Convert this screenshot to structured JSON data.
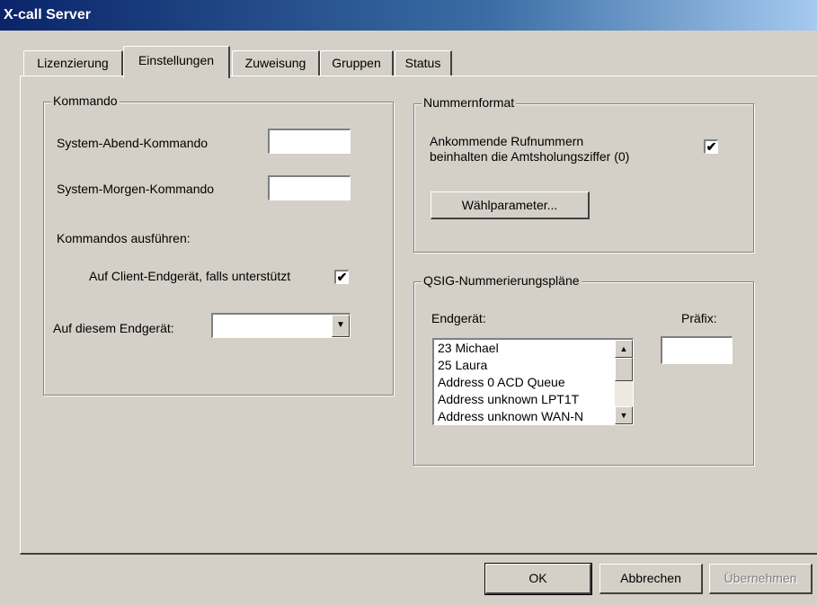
{
  "window": {
    "title": "X-call Server"
  },
  "tabs": [
    {
      "label": "Lizenzierung"
    },
    {
      "label": "Einstellungen"
    },
    {
      "label": "Zuweisung"
    },
    {
      "label": "Gruppen"
    },
    {
      "label": "Status"
    }
  ],
  "kommando": {
    "title": "Kommando",
    "abend_label": "System-Abend-Kommando",
    "abend_value": "",
    "morgen_label": "System-Morgen-Kommando",
    "morgen_value": "",
    "ausfuehren_label": "Kommandos ausführen:",
    "client_label": "Auf Client-Endgerät, falls unterstützt",
    "client_checked": true,
    "endgeraet_label": "Auf diesem Endgerät:",
    "endgeraet_value": ""
  },
  "nummernformat": {
    "title": "Nummernformat",
    "line1": "Ankommende Rufnummern",
    "line2": "beinhalten die Amtsholungsziffer (0)",
    "checked": true,
    "button": "Wählparameter..."
  },
  "qsig": {
    "title": "QSIG-Nummerierungspläne",
    "endgeraet_label": "Endgerät:",
    "praefix_label": "Präfix:",
    "praefix_value": "",
    "items": [
      "23 Michael",
      "25 Laura",
      "Address 0 ACD Queue",
      "Address unknown LPT1T",
      "Address unknown WAN-N"
    ]
  },
  "buttons": {
    "ok": "OK",
    "abbrechen": "Abbrechen",
    "uebernehmen_first": "Ü",
    "uebernehmen_rest": "bernehmen"
  }
}
